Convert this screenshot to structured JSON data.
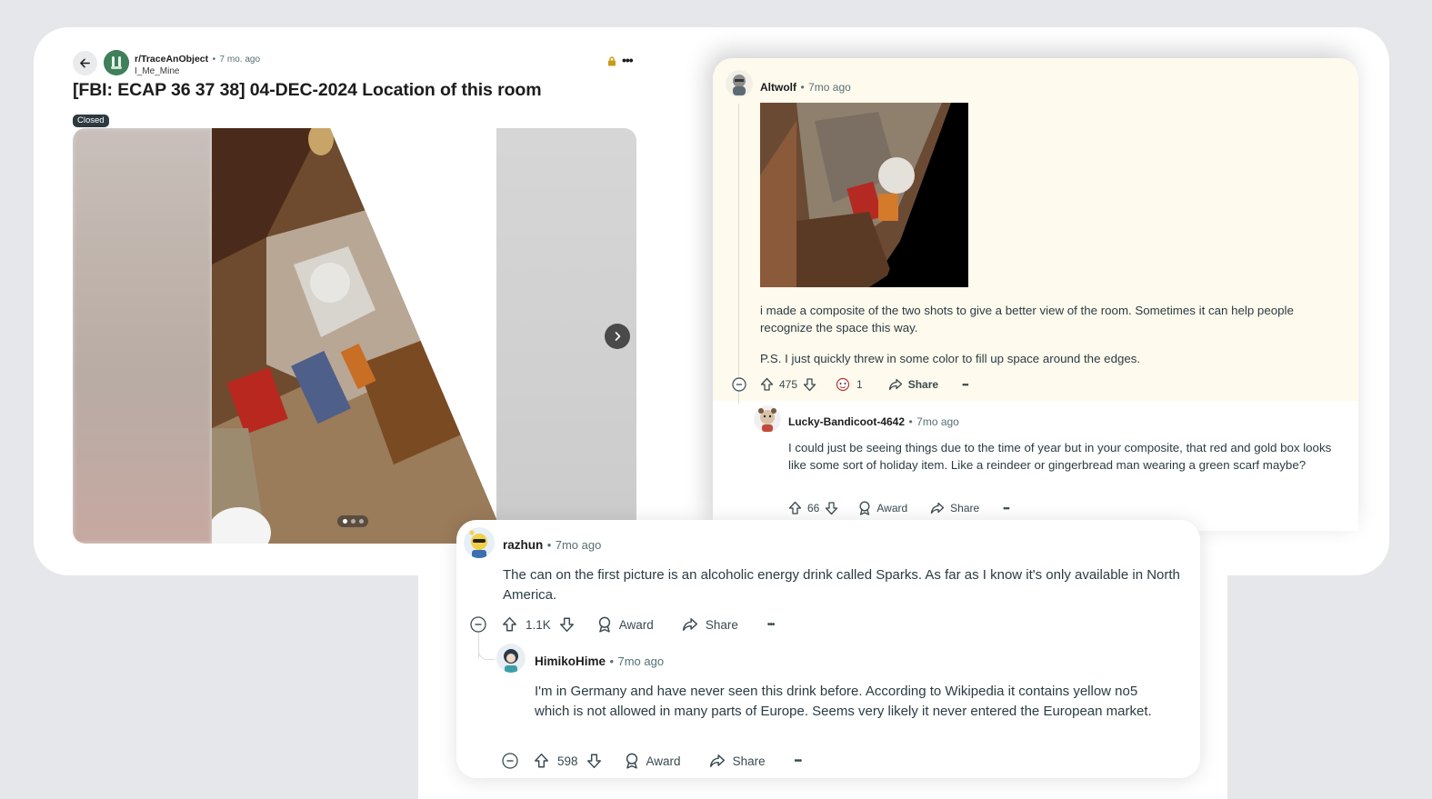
{
  "post": {
    "subreddit": "r/TraceAnObject",
    "separator": "•",
    "time": "7 mo. ago",
    "user": "I_Me_Mine",
    "title": "[FBI: ECAP 36 37 38] 04-DEC-2024 Location of this room",
    "flair": "Closed",
    "more": "•••",
    "carousel": {
      "current": 1,
      "total": 3
    }
  },
  "comments": [
    {
      "author": "Altwolf",
      "time": "7mo ago",
      "body1": "i made a composite of the two shots to give a better view of the room. Sometimes it can help people recognize the space this way.",
      "body2": "P.S. I just quickly threw in some color to fill up space around the edges.",
      "votes": "475",
      "awards": "1",
      "share": "Share",
      "more": "•••"
    },
    {
      "author": "Lucky-Bandicoot-4642",
      "time": "7mo ago",
      "body": "I could just be seeing things due to the time of year but in your composite, that red and gold box looks like some sort of holiday item. Like a reindeer or gingerbread man wearing a green scarf maybe?",
      "votes": "66",
      "award": "Award",
      "share": "Share",
      "more": "•••"
    },
    {
      "author": "razhun",
      "time": "7mo ago",
      "body": "The can on the first picture is an alcoholic energy drink called Sparks. As far as I know it's only available in North America.",
      "votes": "1.1K",
      "award": "Award",
      "share": "Share",
      "more": "•••"
    },
    {
      "author": "HimikoHime",
      "time": "7mo ago",
      "body": "I'm in Germany and have never seen this drink before. According to Wikipedia it contains yellow no5 which is not allowed in many parts of Europe. Seems very likely it never entered the European market.",
      "votes": "598",
      "award": "Award",
      "share": "Share",
      "more": "•••"
    }
  ],
  "meta_separator": "•",
  "colors": {
    "page_bg": "#e6e7ea",
    "highlight_bg": "#fefaed",
    "text_secondary": "#576f76",
    "flair_bg": "#2e3a40"
  }
}
